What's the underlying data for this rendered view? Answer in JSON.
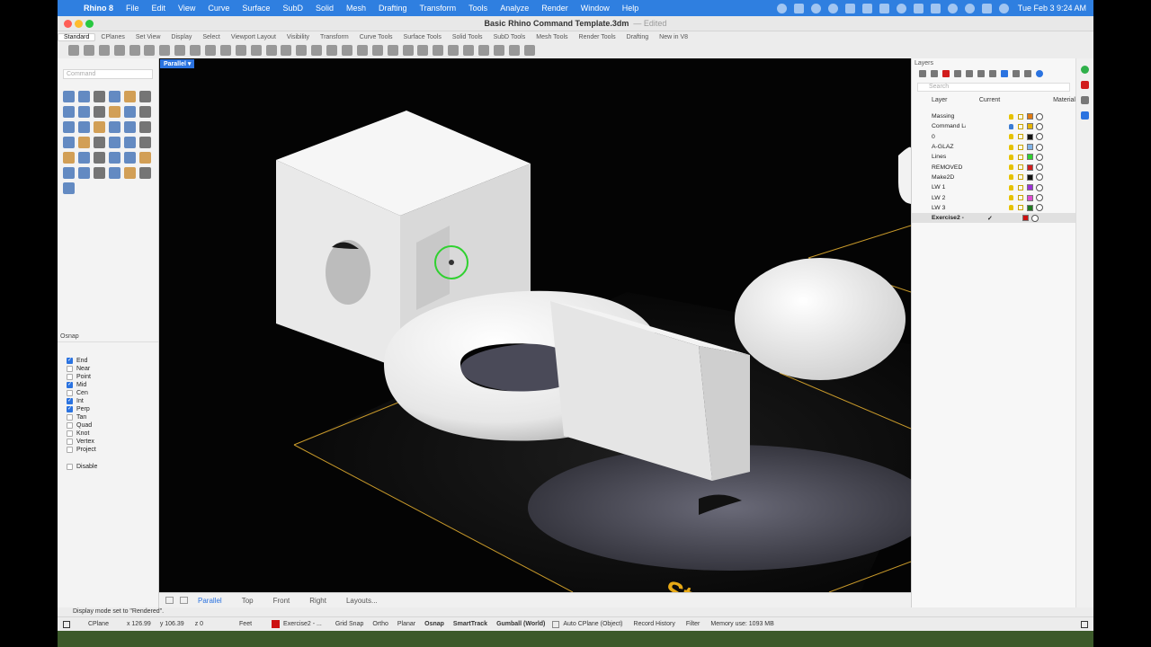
{
  "menubar": {
    "app": "Rhino 8",
    "items": [
      "File",
      "Edit",
      "View",
      "Curve",
      "Surface",
      "SubD",
      "Solid",
      "Mesh",
      "Drafting",
      "Transform",
      "Tools",
      "Analyze",
      "Render",
      "Window",
      "Help"
    ],
    "clock": "Tue Feb 3  9:24 AM"
  },
  "window": {
    "title": "Basic Rhino Command Template.3dm",
    "edited": "— Edited"
  },
  "tabs": [
    "Standard",
    "CPlanes",
    "Set View",
    "Display",
    "Select",
    "Viewport Layout",
    "Visibility",
    "Transform",
    "Curve Tools",
    "Surface Tools",
    "Solid Tools",
    "SubD Tools",
    "Mesh Tools",
    "Render Tools",
    "Drafting",
    "New in V8"
  ],
  "command": {
    "placeholder": "Command"
  },
  "osnap": {
    "title": "Osnap",
    "items": [
      {
        "label": "End",
        "checked": true
      },
      {
        "label": "Near",
        "checked": false
      },
      {
        "label": "Point",
        "checked": false
      },
      {
        "label": "Mid",
        "checked": true
      },
      {
        "label": "Cen",
        "checked": false
      },
      {
        "label": "Int",
        "checked": true
      },
      {
        "label": "Perp",
        "checked": true
      },
      {
        "label": "Tan",
        "checked": false
      },
      {
        "label": "Quad",
        "checked": false
      },
      {
        "label": "Knot",
        "checked": false
      },
      {
        "label": "Vertex",
        "checked": false
      },
      {
        "label": "Project",
        "checked": false
      }
    ],
    "disable": "Disable"
  },
  "viewport": {
    "label": "Parallel ▾",
    "text": "Step"
  },
  "viewport_tabs": [
    "Parallel",
    "Top",
    "Front",
    "Right",
    "Layouts..."
  ],
  "layers": {
    "title": "Layers",
    "search_placeholder": "Search",
    "cols": {
      "layer": "Layer",
      "current": "Current",
      "material": "Material"
    },
    "rows": [
      {
        "name": "Massing",
        "color": "#e07a10"
      },
      {
        "name": "Command La",
        "color": "#e6b400"
      },
      {
        "name": "0",
        "color": "#111111"
      },
      {
        "name": "A-GLAZ",
        "color": "#7fb3e8"
      },
      {
        "name": "Lines",
        "color": "#2fd12f"
      },
      {
        "name": "REMOVED",
        "color": "#d11c1c"
      },
      {
        "name": "Make2D",
        "color": "#111111"
      },
      {
        "name": "LW 1",
        "color": "#9b2fd6"
      },
      {
        "name": "LW 2",
        "color": "#e04ad0"
      },
      {
        "name": "LW 3",
        "color": "#1f7a1f"
      },
      {
        "name": "Exercise2 - I",
        "color": "#cc1111",
        "current": "✓"
      }
    ]
  },
  "status": {
    "message": "Display mode set to \"Rendered\".",
    "cplane": "CPlane",
    "x": "x 126.99",
    "y": "y 106.39",
    "z": "z 0",
    "units": "Feet",
    "layer": "Exercise2 - ...",
    "grid_snap": "Grid Snap",
    "ortho": "Ortho",
    "planar": "Planar",
    "osnap": "Osnap",
    "smarttrack": "SmartTrack",
    "gumball": "Gumball (World)",
    "auto_cplane": "Auto CPlane (Object)",
    "record_history": "Record History",
    "filter": "Filter",
    "memory": "Memory use: 1093 MB"
  },
  "colors": {
    "accent": "#2b73e0",
    "menubar": "#2f7fe0",
    "current_layer": "#cc1111"
  }
}
